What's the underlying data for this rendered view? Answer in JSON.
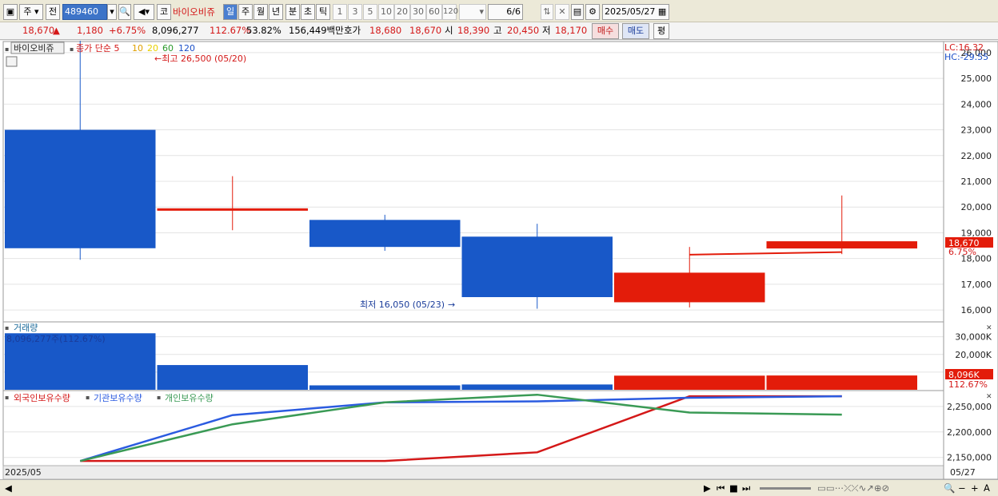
{
  "toolbar": {
    "market": "주",
    "prev_label": "전",
    "code": "489460",
    "stock_name": "바이오비쥬",
    "market_badge": "코",
    "periods": [
      "일",
      "주",
      "월",
      "년",
      "분",
      "초",
      "틱"
    ],
    "active_period": "일",
    "intervals": [
      "1",
      "3",
      "5",
      "10",
      "20",
      "30",
      "60",
      "120"
    ],
    "page_counter": "6/6",
    "date": "2025/05/27"
  },
  "quote": {
    "price": "18,670",
    "arrow": "▲",
    "change": "1,180",
    "change_pct": "+6.75%",
    "volume": "8,096,277",
    "volume_ratio": "112.67%",
    "turnover_pct": "53.82%",
    "trade_value": "156,449백만",
    "bid_label": "호가",
    "bid": "18,680",
    "open_label": "시",
    "open_value": "18,670",
    "open2": "18,390",
    "high_label": "고",
    "high": "20,450",
    "low_label": "저",
    "low": "18,170",
    "buy_label": "매수",
    "sell_label": "매도",
    "eval_label": "평"
  },
  "price_panel": {
    "legend_name": "바이오비쥬",
    "legend_ma": "종가 단순 5",
    "ma_periods": [
      "10",
      "20",
      "60",
      "120"
    ],
    "high_note": "←최고 26,500 (05/20)",
    "low_note": "최저 16,050 (05/23)",
    "lc": "LC:16.32",
    "hc": "HC:-29.55",
    "last_price_tag": "18,670",
    "last_pct_tag": "6.75%"
  },
  "volume_panel": {
    "title": "거래량",
    "info": "8,096,277주(112.67%)",
    "last_tag": "8,096K",
    "last_pct_tag": "112.67%"
  },
  "holding_panel": {
    "legend": [
      "외국인보유수량",
      "기관보유수량",
      "개인보유수량"
    ]
  },
  "footer": {
    "left_date": "2025/05",
    "right_date": "05/27"
  },
  "colors": {
    "up": "#e31c0a",
    "down": "#1858c8",
    "foreign": "#d41818",
    "institution": "#2b5be0",
    "individual": "#3a9a55"
  },
  "chart_data": [
    {
      "type": "candlestick",
      "title": "바이오비쥬",
      "unit": "KRW",
      "ylim": [
        15600,
        26400
      ],
      "yticks": [
        16000,
        17000,
        18000,
        19000,
        20000,
        21000,
        22000,
        23000,
        24000,
        25000,
        26000
      ],
      "candles": [
        {
          "open": 23000,
          "close": 18400,
          "high": 26500,
          "low": 17950
        },
        {
          "open": 19950,
          "close": 19950,
          "high": 21200,
          "low": 19100
        },
        {
          "open": 19500,
          "close": 18450,
          "high": 19700,
          "low": 18300
        },
        {
          "open": 18850,
          "close": 16500,
          "high": 19350,
          "low": 16050
        },
        {
          "open": 16300,
          "close": 17450,
          "high": 18450,
          "low": 16100
        },
        {
          "open": 18390,
          "close": 18670,
          "high": 20450,
          "low": 18170
        }
      ],
      "ma5": [
        null,
        null,
        null,
        null,
        18150,
        18250
      ]
    },
    {
      "type": "bar",
      "title": "거래량",
      "yticks": [
        "10,000K",
        "20,000K",
        "30,000K"
      ],
      "ylim": [
        0,
        38000000
      ],
      "values": [
        32000000,
        14000000,
        2500000,
        3000000,
        8000000,
        8096277
      ],
      "directions": [
        "down",
        "down",
        "down",
        "down",
        "up",
        "up"
      ]
    },
    {
      "type": "line",
      "yticks": [
        2150000,
        2200000,
        2250000
      ],
      "ylim": [
        2137000,
        2278000
      ],
      "series": [
        {
          "name": "외국인보유수량",
          "values": [
            2143000,
            2143000,
            2143000,
            2160000,
            2270000,
            2270000
          ]
        },
        {
          "name": "기관보유수량",
          "values": [
            2143000,
            2233000,
            2258000,
            2260000,
            2267000,
            2270000
          ]
        },
        {
          "name": "개인보유수량",
          "values": [
            2143000,
            2215000,
            2258000,
            2273000,
            2238000,
            2234000
          ]
        }
      ]
    }
  ]
}
